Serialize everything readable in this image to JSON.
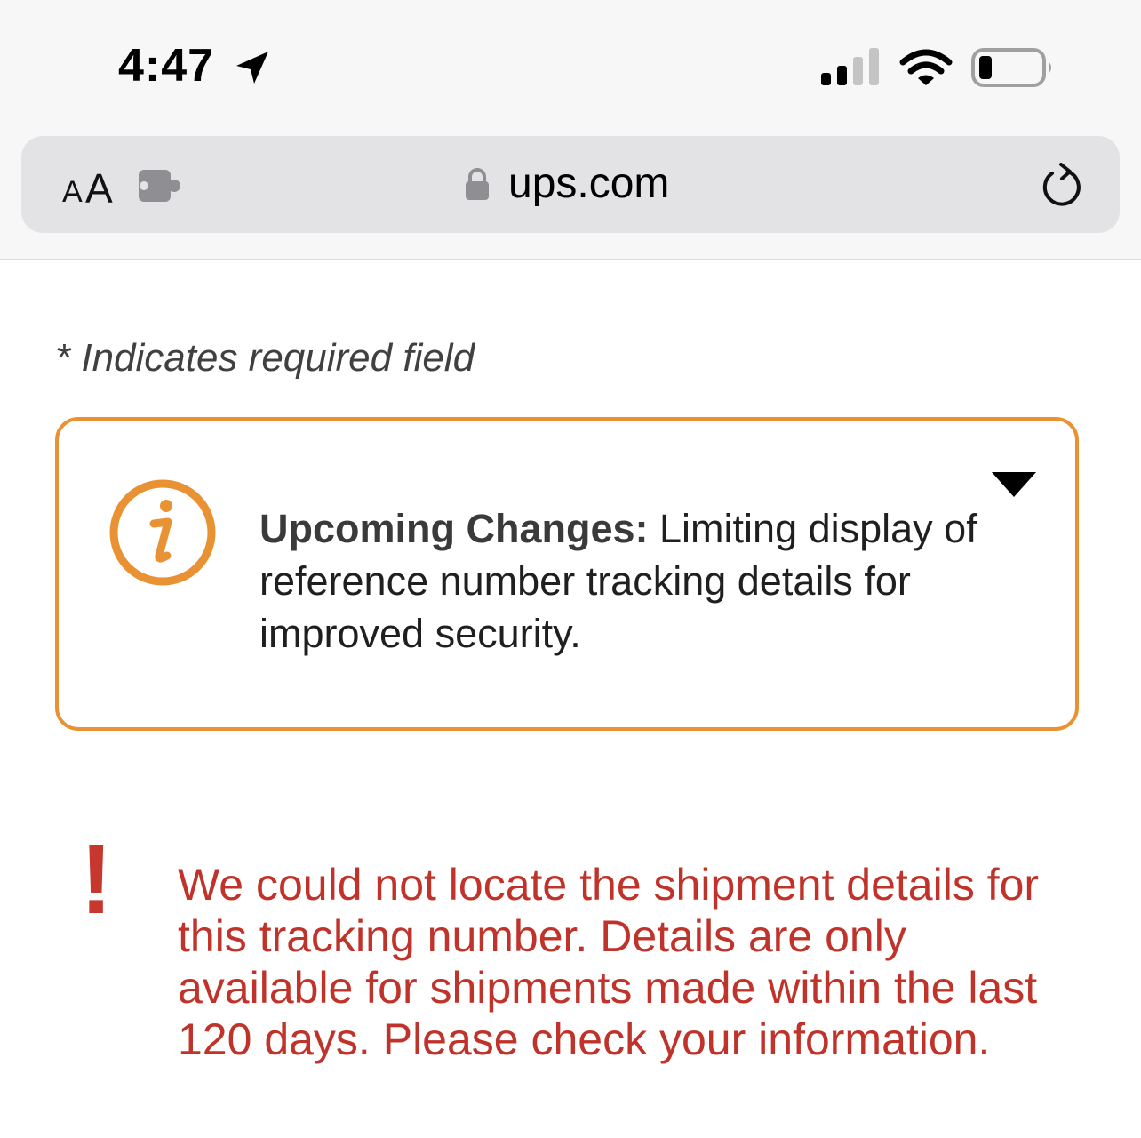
{
  "status_bar": {
    "time": "4:47",
    "icons": [
      "location-arrow-icon",
      "cellular-signal-icon",
      "wifi-icon",
      "battery-icon"
    ]
  },
  "browser": {
    "aa_small": "A",
    "aa_big": "A",
    "url": "ups.com",
    "icons": [
      "extension-icon",
      "lock-icon",
      "reload-icon"
    ]
  },
  "page": {
    "required_note": "* Indicates required field",
    "notice": {
      "title": "Upcoming Changes:",
      "body": " Limiting display of reference number tracking details for improved security.",
      "icon": "info-icon",
      "toggle_icon": "triangle-down-icon",
      "border_color": "#e99233"
    },
    "error": {
      "icon": "!",
      "message": "We could not locate the shipment details for this tracking number. Details are only available for shipments made within the last 120 days. Please check your information.",
      "color": "#c0332a"
    }
  }
}
